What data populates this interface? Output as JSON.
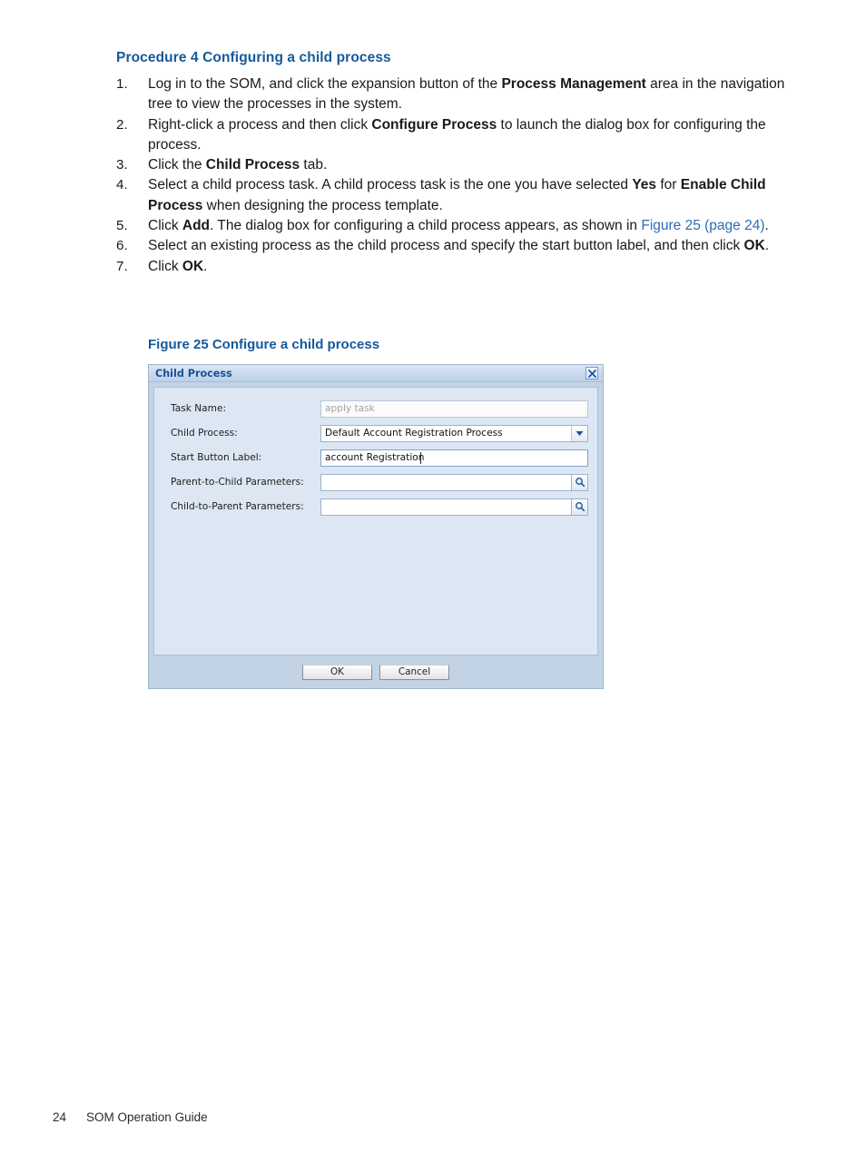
{
  "heading": "Procedure 4 Configuring a child process",
  "steps": [
    {
      "num": "1.",
      "parts": [
        {
          "t": "Log in to the SOM, and click the expansion button of the ",
          "s": "n"
        },
        {
          "t": "Process Management",
          "s": "b"
        },
        {
          "t": " area in the navigation tree to view the processes in the system.",
          "s": "n"
        }
      ]
    },
    {
      "num": "2.",
      "parts": [
        {
          "t": "Right-click a process and then click ",
          "s": "n"
        },
        {
          "t": "Configure Process",
          "s": "b"
        },
        {
          "t": " to launch the dialog box for configuring the process.",
          "s": "n"
        }
      ]
    },
    {
      "num": "3.",
      "parts": [
        {
          "t": "Click the ",
          "s": "n"
        },
        {
          "t": "Child Process",
          "s": "b"
        },
        {
          "t": " tab.",
          "s": "n"
        }
      ]
    },
    {
      "num": "4.",
      "parts": [
        {
          "t": "Select a child process task. A child process task is the one you have selected ",
          "s": "n"
        },
        {
          "t": "Yes",
          "s": "b"
        },
        {
          "t": " for ",
          "s": "n"
        },
        {
          "t": "Enable Child Process",
          "s": "b"
        },
        {
          "t": " when designing the process template.",
          "s": "n"
        }
      ]
    },
    {
      "num": "5.",
      "parts": [
        {
          "t": "Click ",
          "s": "n"
        },
        {
          "t": "Add",
          "s": "b"
        },
        {
          "t": ". The dialog box for configuring a child process appears, as shown in ",
          "s": "n"
        },
        {
          "t": "Figure 25 (page 24)",
          "s": "l"
        },
        {
          "t": ".",
          "s": "n"
        }
      ]
    },
    {
      "num": "6.",
      "parts": [
        {
          "t": "Select an existing process as the child process and specify the start button label, and then click ",
          "s": "n"
        },
        {
          "t": "OK",
          "s": "b"
        },
        {
          "t": ".",
          "s": "n"
        }
      ]
    },
    {
      "num": "7.",
      "parts": [
        {
          "t": "Click ",
          "s": "n"
        },
        {
          "t": "OK",
          "s": "b"
        },
        {
          "t": ".",
          "s": "n"
        }
      ]
    }
  ],
  "figure": {
    "caption": "Figure 25 Configure a child process"
  },
  "dialog": {
    "title": "Child Process",
    "close_icon": "close-x-icon",
    "fields": [
      {
        "label": "Task Name:",
        "type": "text-readonly",
        "value": "apply task",
        "name": "task-name"
      },
      {
        "label": "Child Process:",
        "type": "select",
        "value": "Default Account Registration Process",
        "arrow_icon": "chevron-down-icon",
        "name": "child-process"
      },
      {
        "label": "Start Button Label:",
        "type": "text",
        "value": "account Registration",
        "name": "start-button-label"
      },
      {
        "label": "Parent-to-Child Parameters:",
        "type": "search",
        "value": "",
        "button_icon": "magnifier-icon",
        "name": "parent-to-child-parameters"
      },
      {
        "label": "Child-to-Parent Parameters:",
        "type": "search",
        "value": "",
        "button_icon": "magnifier-icon",
        "name": "child-to-parent-parameters"
      }
    ],
    "buttons": {
      "ok": "OK",
      "cancel": "Cancel"
    }
  },
  "footer": {
    "page_number": "24",
    "doc_title": "SOM Operation Guide"
  },
  "colors": {
    "heading_blue": "#14599b",
    "link_blue": "#2a6db5",
    "dialog_title_blue": "#1b4f99",
    "dialog_frame": "#c3d3e6",
    "dialog_body": "#dde7f4"
  }
}
